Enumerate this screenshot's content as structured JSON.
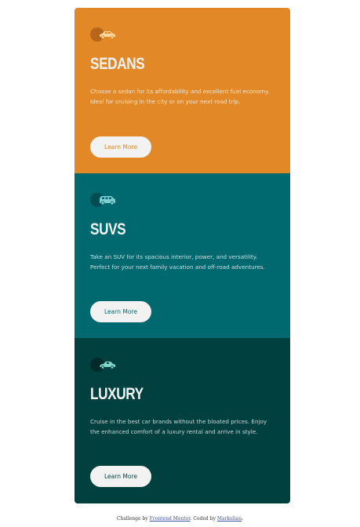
{
  "colors": {
    "sedans_bg": "#e38826",
    "suvs_bg": "#006970",
    "luxury_bg": "#004140",
    "button_bg": "#f2f2f2",
    "link": "#3e52a3"
  },
  "cards": [
    {
      "icon": "sedan-car-icon",
      "title": "SEDANS",
      "text": "Choose a sedan for its affordability and excellent fuel economy. Ideal for cruising in the city or on your next road trip.",
      "button_label": "Learn More"
    },
    {
      "icon": "suv-car-icon",
      "title": "SUVS",
      "text": "Take an SUV for its spacious interior, power, and versatility. Perfect for your next family vacation and off-road adventures.",
      "button_label": "Learn More"
    },
    {
      "icon": "luxury-car-icon",
      "title": "LUXURY",
      "text": "Cruise in the best car brands without the bloated prices. Enjoy the enhanced comfort of a luxury rental and arrive in style.",
      "button_label": "Learn More"
    }
  ],
  "attribution": {
    "prefix": "Challenge by",
    "challenge_link": "Frontend Mentor",
    "middle": ". Coded by",
    "author_link": "Markuliau",
    "suffix": "."
  }
}
